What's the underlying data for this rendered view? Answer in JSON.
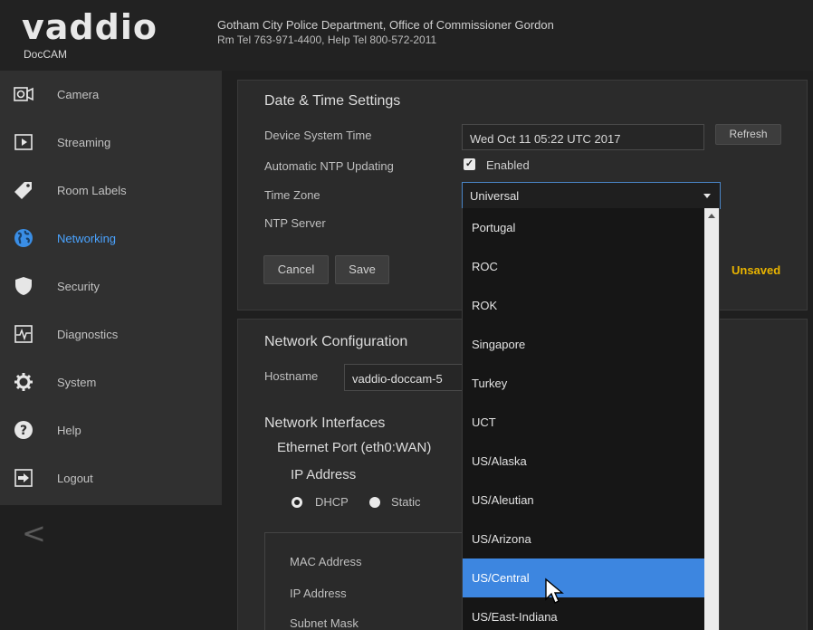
{
  "header": {
    "logo": "vaddio",
    "product": "DocCAM",
    "org_line1": "Gotham City Police Department, Office of Commissioner Gordon",
    "org_line2": "Rm Tel 763-971-4400, Help Tel 800-572-2011"
  },
  "sidebar": {
    "items": [
      {
        "label": "Camera",
        "icon": "camera-icon"
      },
      {
        "label": "Streaming",
        "icon": "play-icon"
      },
      {
        "label": "Room Labels",
        "icon": "tag-icon"
      },
      {
        "label": "Networking",
        "icon": "globe-icon",
        "active": true
      },
      {
        "label": "Security",
        "icon": "shield-icon"
      },
      {
        "label": "Diagnostics",
        "icon": "pulse-icon"
      },
      {
        "label": "System",
        "icon": "gear-icon"
      },
      {
        "label": "Help",
        "icon": "help-icon"
      },
      {
        "label": "Logout",
        "icon": "logout-icon"
      }
    ],
    "collapse": "<"
  },
  "datetime": {
    "title": "Date & Time Settings",
    "device_time_label": "Device System Time",
    "device_time_value": "Wed Oct 11 05:22 UTC 2017",
    "refresh_label": "Refresh",
    "ntp_label": "Automatic NTP Updating",
    "ntp_enabled_label": "Enabled",
    "ntp_enabled": true,
    "timezone_label": "Time Zone",
    "timezone_value": "Universal",
    "ntp_server_label": "NTP Server",
    "cancel_label": "Cancel",
    "save_label": "Save",
    "unsaved_label": "Unsaved"
  },
  "timezone_dropdown": {
    "options": [
      "Portugal",
      "ROC",
      "ROK",
      "Singapore",
      "Turkey",
      "UCT",
      "US/Alaska",
      "US/Aleutian",
      "US/Arizona",
      "US/Central",
      "US/East-Indiana"
    ],
    "highlighted": "US/Central"
  },
  "network": {
    "title": "Network Configuration",
    "hostname_label": "Hostname",
    "hostname_value": "vaddio-doccam-5",
    "interfaces_title": "Network Interfaces",
    "ethernet_label": "Ethernet Port (eth0:WAN)",
    "ip_address_title": "IP Address",
    "dhcp_label": "DHCP",
    "static_label": "Static",
    "mode": "DHCP",
    "mac_label": "MAC Address",
    "ip_label": "IP Address",
    "subnet_label": "Subnet Mask"
  },
  "colors": {
    "accent": "#4aa3ff",
    "highlight": "#3d86e0",
    "unsaved": "#e9b400"
  }
}
